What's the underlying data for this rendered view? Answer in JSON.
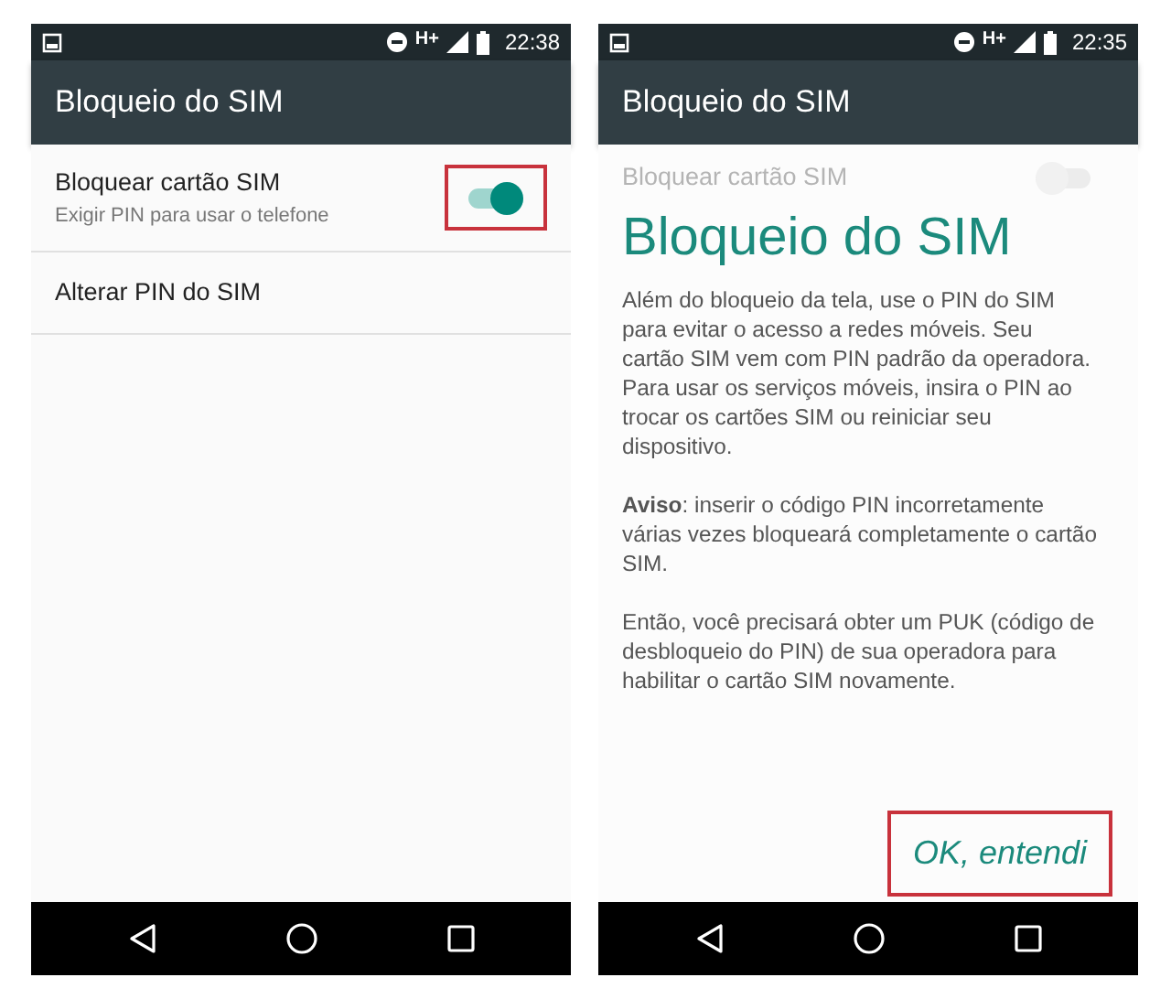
{
  "screens": [
    {
      "status_bar": {
        "network": "H+",
        "time": "22:38"
      },
      "title": "Bloqueio do SIM",
      "faded": false,
      "items": [
        {
          "kind": "switch",
          "title": "Bloquear cartão SIM",
          "subtitle": "Exigir PIN para usar o telefone",
          "on": true,
          "highlighted": true
        },
        {
          "kind": "plain",
          "title": "Alterar PIN do SIM"
        }
      ]
    },
    {
      "status_bar": {
        "network": "H+",
        "time": "22:35"
      },
      "title": "Bloqueio do SIM",
      "faded": true,
      "items": [
        {
          "kind": "switch",
          "title": "Bloquear cartão SIM",
          "on": false,
          "highlighted": false
        }
      ],
      "overlay": {
        "heading": "Bloqueio do SIM",
        "paragraphs": [
          "Além do bloqueio da tela, use o PIN do SIM para evitar o acesso a redes móveis. Seu cartão SIM vem com PIN padrão da operadora. Para usar os serviços móveis, insira o PIN ao trocar os cartões SIM ou reiniciar seu dispositivo.",
          "**Aviso**: inserir o código PIN incorretamente várias vezes bloqueará completamente o cartão SIM.",
          "Então, você precisará obter um PUK (código de desbloqueio do PIN) de sua operadora para habilitar o cartão SIM novamente."
        ],
        "button": {
          "label": "OK, entendi",
          "highlighted": true
        }
      }
    }
  ]
}
